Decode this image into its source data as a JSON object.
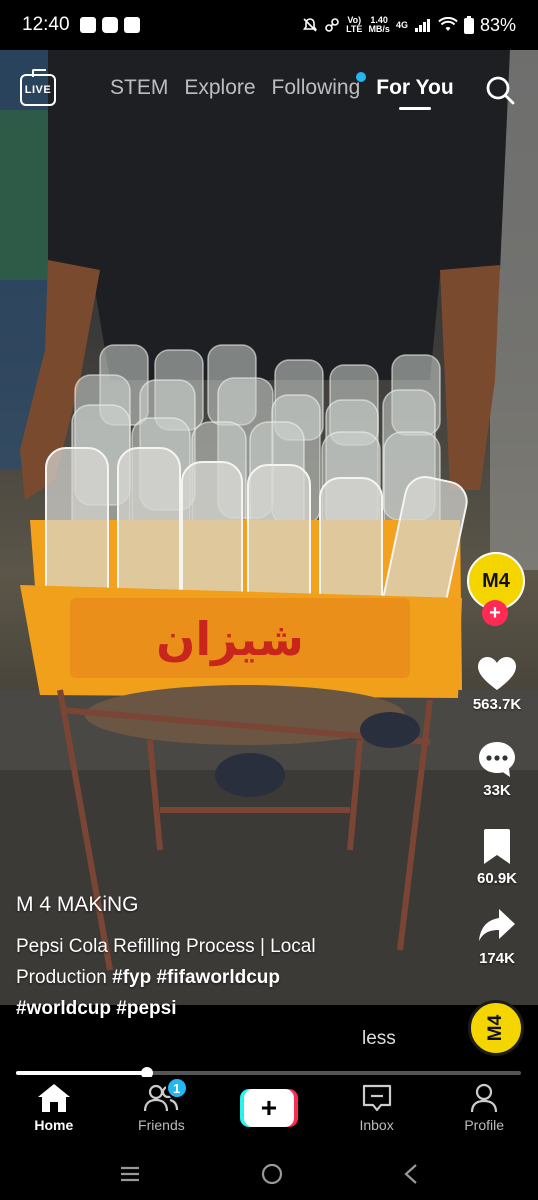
{
  "status_bar": {
    "time": "12:40",
    "network_left": "Vo)",
    "network_right": "LTE",
    "speed_value": "1.40",
    "speed_unit": "MB/s",
    "network_type": "4G",
    "battery": "83%"
  },
  "top_nav": {
    "live_label": "LIVE",
    "tabs": [
      {
        "label": "STEM",
        "active": false
      },
      {
        "label": "Explore",
        "active": false
      },
      {
        "label": "Following",
        "active": false
      },
      {
        "label": "For You",
        "active": true
      }
    ]
  },
  "video": {
    "crate_text": "شیزان"
  },
  "rail": {
    "avatar_text": "M4",
    "likes": "563.7K",
    "comments": "33K",
    "saves": "60.9K",
    "shares": "174K"
  },
  "caption": {
    "username": "M 4 MAKiNG",
    "description": "Pepsi Cola Refilling Process | Local Production",
    "hashtags_line1": "#fyp #fifaworldcup",
    "hashtags_line2": "#worldcup #pepsi",
    "less_label": "less"
  },
  "music_disc_text": "M4",
  "progress": {
    "fraction": 0.26
  },
  "bottom_nav": {
    "items": [
      {
        "label": "Home",
        "active": true
      },
      {
        "label": "Friends",
        "active": false,
        "badge": "1"
      },
      {
        "label": "",
        "active": false
      },
      {
        "label": "Inbox",
        "active": false
      },
      {
        "label": "Profile",
        "active": false
      }
    ]
  },
  "colors": {
    "accent_red": "#fe2c55",
    "accent_cyan": "#25f4ee",
    "badge_blue": "#25b7f0",
    "crate_orange": "#f2a21c",
    "avatar_yellow": "#f5d500"
  }
}
